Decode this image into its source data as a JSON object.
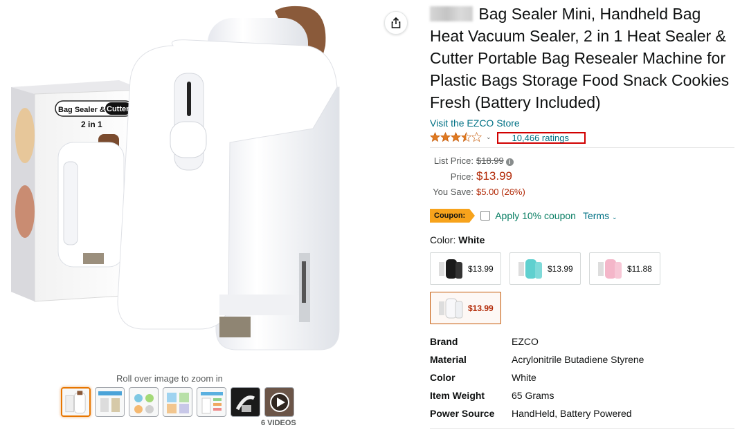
{
  "product": {
    "title_brand": "EZCO",
    "title_rest": " Bag Sealer Mini, Handheld Bag Heat Vacuum Sealer, 2 in 1 Heat Sealer & Cutter Portable Bag Resealer Machine for Plastic Bags Storage Food Snack Cookies Fresh (Battery Included)",
    "store_link": "Visit the EZCO Store",
    "rating_value": 3.5,
    "ratings_count": "10,466 ratings"
  },
  "box_art": {
    "brand_text": "Bag Sealer &",
    "cutter_text": "Cutter",
    "two_in_one": "2 in 1"
  },
  "gallery": {
    "zoom_hint": "Roll over image to zoom in",
    "thumbnails": [
      "thumb-1",
      "thumb-2",
      "thumb-3",
      "thumb-4",
      "thumb-5",
      "thumb-6",
      "video-thumb"
    ],
    "videos_label": "6 VIDEOS"
  },
  "pricing": {
    "list_price_label": "List Price:",
    "list_price": "$18.99",
    "price_label": "Price:",
    "price": "$13.99",
    "save_label": "You Save:",
    "save_value": "$5.00 (26%)"
  },
  "coupon": {
    "badge": "Coupon:",
    "text": "Apply 10% coupon",
    "terms": "Terms"
  },
  "color": {
    "label": "Color:",
    "selected": "White",
    "options": [
      {
        "name": "Black",
        "price": "$13.99",
        "color": "#1a1a1a"
      },
      {
        "name": "Teal",
        "price": "$13.99",
        "color": "#5fd0cf"
      },
      {
        "name": "Pink",
        "price": "$11.88",
        "color": "#f4b6c9"
      },
      {
        "name": "White",
        "price": "$13.99",
        "color": "#f2f3f5"
      }
    ]
  },
  "specs": [
    {
      "key": "Brand",
      "value": "EZCO"
    },
    {
      "key": "Material",
      "value": "Acrylonitrile Butadiene Styrene"
    },
    {
      "key": "Color",
      "value": "White"
    },
    {
      "key": "Item Weight",
      "value": "65 Grams"
    },
    {
      "key": "Power Source",
      "value": "HandHeld, Battery Powered"
    }
  ],
  "colors": {
    "link": "#007185",
    "price_red": "#b12704",
    "coupon_orange": "#f7a31c",
    "highlight_red": "#d10000"
  }
}
